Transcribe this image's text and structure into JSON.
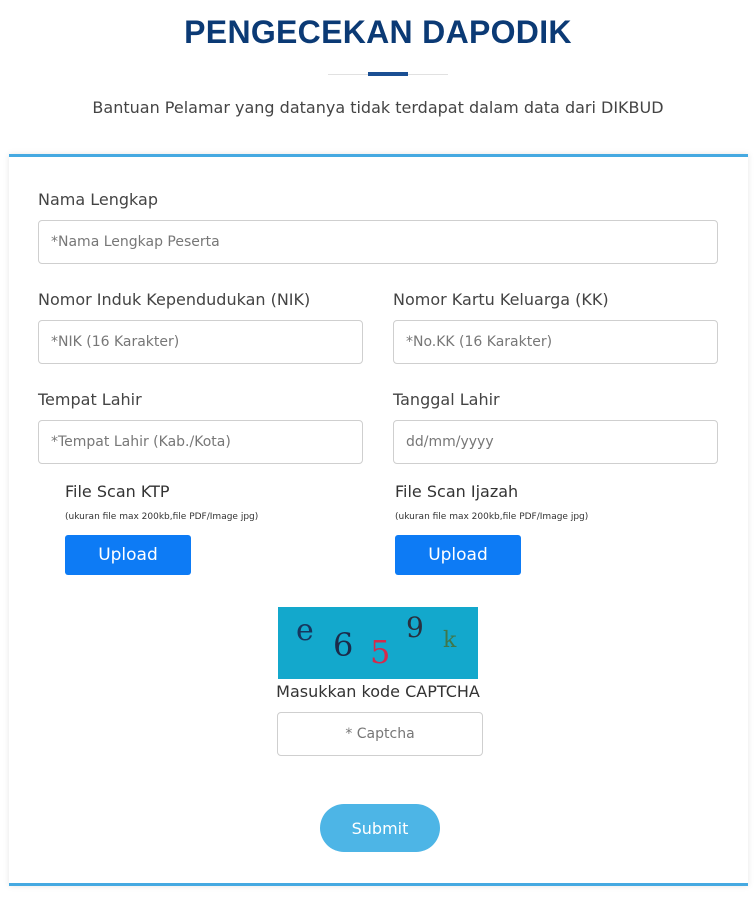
{
  "header": {
    "title": "PENGECEKAN DAPODIK",
    "subtitle": "Bantuan Pelamar yang datanya tidak terdapat dalam data dari DIKBUD"
  },
  "form": {
    "full_name": {
      "label": "Nama Lengkap",
      "placeholder": "*Nama Lengkap Peserta",
      "value": ""
    },
    "nik": {
      "label": "Nomor Induk Kependudukan (NIK)",
      "placeholder": "*NIK (16 Karakter)",
      "value": ""
    },
    "kk": {
      "label": "Nomor Kartu Keluarga (KK)",
      "placeholder": "*No.KK (16 Karakter)",
      "value": ""
    },
    "birth_place": {
      "label": "Tempat Lahir",
      "placeholder": "*Tempat Lahir (Kab./Kota)",
      "value": ""
    },
    "birth_date": {
      "label": "Tanggal Lahir",
      "placeholder": "dd/mm/yyyy",
      "value": ""
    },
    "ktp_upload": {
      "label": "File Scan KTP",
      "hint": "(ukuran file max 200kb,file PDF/Image jpg)",
      "button": "Upload"
    },
    "ijazah_upload": {
      "label": "File Scan Ijazah",
      "hint": "(ukuran file max 200kb,file PDF/Image jpg)",
      "button": "Upload"
    },
    "captcha": {
      "characters": [
        "e",
        "6",
        "5",
        "9",
        "k"
      ],
      "label": "Masukkan kode CAPTCHA",
      "placeholder": "* Captcha",
      "value": ""
    },
    "submit_label": "Submit"
  },
  "colors": {
    "title": "#0b3a75",
    "card_border": "#45a9e1",
    "upload_button": "#0d7bf5",
    "submit_button": "#4db5e6",
    "captcha_background": "#13a8cc"
  }
}
